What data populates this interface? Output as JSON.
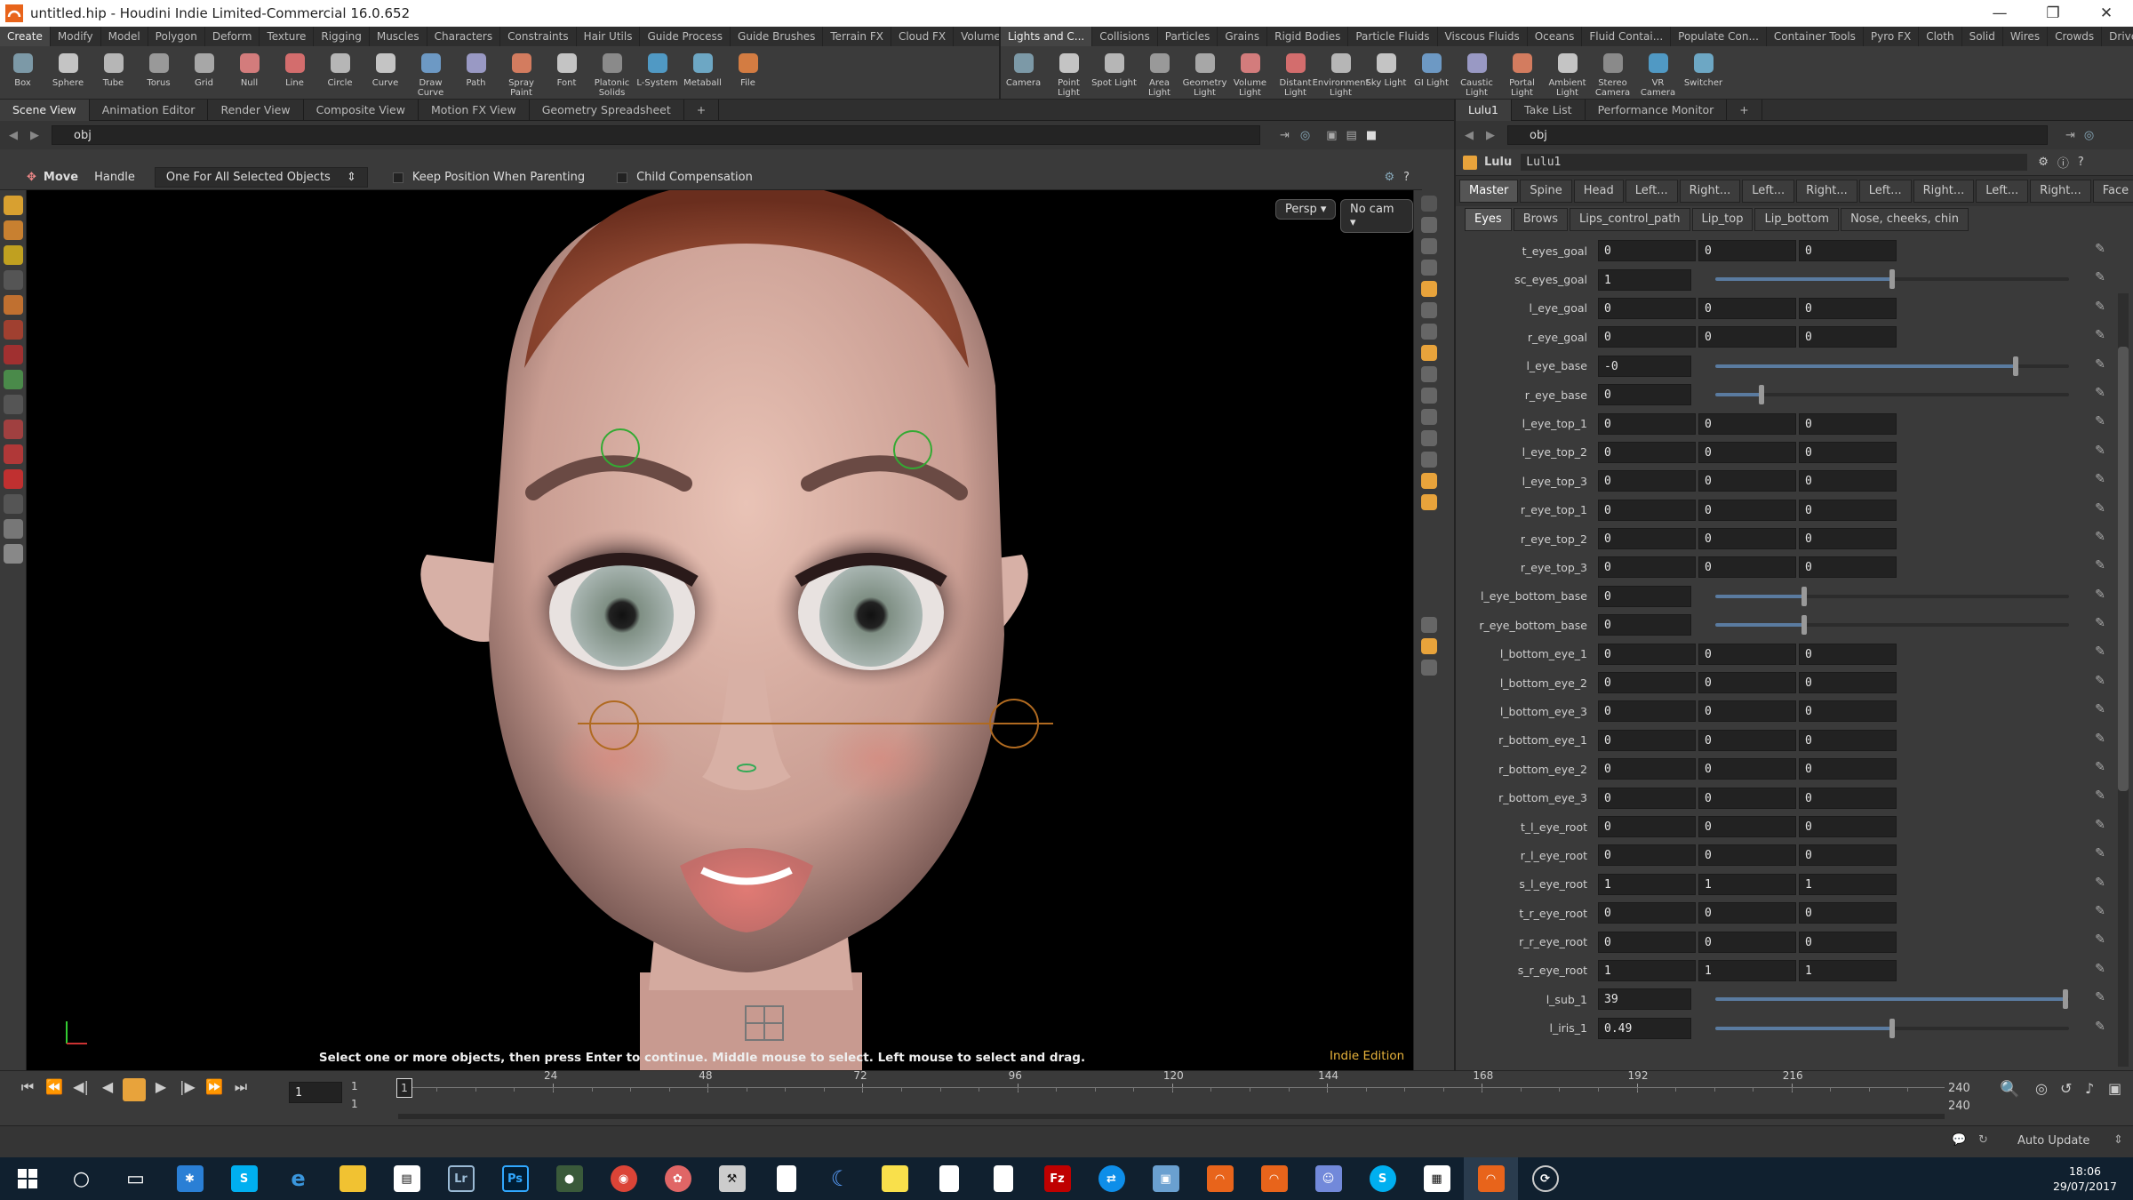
{
  "window": {
    "title": "untitled.hip - Houdini Indie Limited-Commercial 16.0.652",
    "controls": [
      "—",
      "❐",
      "✕"
    ]
  },
  "shelf_left": {
    "tabs": [
      "Create",
      "Modify",
      "Model",
      "Polygon",
      "Deform",
      "Texture",
      "Rigging",
      "Muscles",
      "Characters",
      "Constraints",
      "Hair Utils",
      "Guide Process",
      "Guide Brushes",
      "Terrain FX",
      "Cloud FX",
      "Volume"
    ],
    "tools": [
      {
        "label": "Box",
        "icon": "box-icon"
      },
      {
        "label": "Sphere",
        "icon": "sphere-icon"
      },
      {
        "label": "Tube",
        "icon": "tube-icon"
      },
      {
        "label": "Torus",
        "icon": "torus-icon"
      },
      {
        "label": "Grid",
        "icon": "grid-icon"
      },
      {
        "label": "Null",
        "icon": "null-icon"
      },
      {
        "label": "Line",
        "icon": "line-icon"
      },
      {
        "label": "Circle",
        "icon": "circle-icon"
      },
      {
        "label": "Curve",
        "icon": "curve-icon"
      },
      {
        "label": "Draw Curve",
        "icon": "draw-curve-icon"
      },
      {
        "label": "Path",
        "icon": "path-icon"
      },
      {
        "label": "Spray Paint",
        "icon": "spray-paint-icon"
      },
      {
        "label": "Font",
        "icon": "font-icon"
      },
      {
        "label": "Platonic Solids",
        "icon": "platonic-icon"
      },
      {
        "label": "L-System",
        "icon": "lsystem-icon"
      },
      {
        "label": "Metaball",
        "icon": "metaball-icon"
      },
      {
        "label": "File",
        "icon": "file-icon"
      }
    ]
  },
  "shelf_right": {
    "tabs": [
      "Lights and C...",
      "Collisions",
      "Particles",
      "Grains",
      "Rigid Bodies",
      "Particle Fluids",
      "Viscous Fluids",
      "Oceans",
      "Fluid Contai...",
      "Populate Con...",
      "Container Tools",
      "Pyro FX",
      "Cloth",
      "Solid",
      "Wires",
      "Crowds",
      "Drive Simula..."
    ],
    "tools": [
      {
        "label": "Camera",
        "icon": "camera-icon"
      },
      {
        "label": "Point Light",
        "icon": "point-light-icon"
      },
      {
        "label": "Spot Light",
        "icon": "spot-light-icon"
      },
      {
        "label": "Area Light",
        "icon": "area-light-icon"
      },
      {
        "label": "Geometry Light",
        "icon": "geometry-light-icon"
      },
      {
        "label": "Volume Light",
        "icon": "volume-light-icon"
      },
      {
        "label": "Distant Light",
        "icon": "distant-light-icon"
      },
      {
        "label": "Environment Light",
        "icon": "environment-light-icon"
      },
      {
        "label": "Sky Light",
        "icon": "sky-light-icon"
      },
      {
        "label": "GI Light",
        "icon": "gi-light-icon"
      },
      {
        "label": "Caustic Light",
        "icon": "caustic-light-icon"
      },
      {
        "label": "Portal Light",
        "icon": "portal-light-icon"
      },
      {
        "label": "Ambient Light",
        "icon": "ambient-light-icon"
      },
      {
        "label": "Stereo Camera",
        "icon": "stereo-camera-icon"
      },
      {
        "label": "VR Camera",
        "icon": "vr-camera-icon"
      },
      {
        "label": "Switcher",
        "icon": "switcher-icon"
      }
    ]
  },
  "left_pane": {
    "tabs": [
      "Scene View",
      "Animation Editor",
      "Render View",
      "Composite View",
      "Motion FX View",
      "Geometry Spreadsheet"
    ],
    "path": "obj"
  },
  "opbar": {
    "tool": "Move",
    "handle": "Handle",
    "mode": "One For All Selected Objects",
    "keep": "Keep Position When Parenting",
    "child": "Child Compensation"
  },
  "viewport": {
    "persp": "Persp ▾",
    "cam": "No cam ▾",
    "hint": "Select one or more objects, then press Enter to continue. Middle mouse to select. Left mouse to select and drag.",
    "edition": "Indie Edition"
  },
  "right_pane": {
    "tabs": [
      "Lulu1",
      "Take List",
      "Performance Monitor"
    ],
    "path": "obj",
    "node_type": "Lulu",
    "node_name": "Lulu1",
    "tabs1": [
      "Master",
      "Spine",
      "Head",
      "Left...",
      "Right...",
      "Left...",
      "Right...",
      "Left...",
      "Right...",
      "Left...",
      "Right...",
      "Face"
    ],
    "tabs2": [
      "Eyes",
      "Brows",
      "Lips_control_path",
      "Lip_top",
      "Lip_bottom",
      "Nose, cheeks, chin"
    ],
    "params": [
      {
        "label": "t_eyes_goal",
        "type": "vec",
        "v": [
          "0",
          "0",
          "0"
        ]
      },
      {
        "label": "sc_eyes_goal",
        "type": "slider",
        "v": "1",
        "pos": 0.5
      },
      {
        "label": "l_eye_goal",
        "type": "vec",
        "v": [
          "0",
          "0",
          "0"
        ]
      },
      {
        "label": "r_eye_goal",
        "type": "vec",
        "v": [
          "0",
          "0",
          "0"
        ]
      },
      {
        "label": "l_eye_base",
        "type": "slider",
        "v": "-0",
        "pos": 0.85
      },
      {
        "label": "r_eye_base",
        "type": "slider",
        "v": "0",
        "pos": 0.13
      },
      {
        "label": "l_eye_top_1",
        "type": "vec",
        "v": [
          "0",
          "0",
          "0"
        ]
      },
      {
        "label": "l_eye_top_2",
        "type": "vec",
        "v": [
          "0",
          "0",
          "0"
        ]
      },
      {
        "label": "l_eye_top_3",
        "type": "vec",
        "v": [
          "0",
          "0",
          "0"
        ]
      },
      {
        "label": "r_eye_top_1",
        "type": "vec",
        "v": [
          "0",
          "0",
          "0"
        ]
      },
      {
        "label": "r_eye_top_2",
        "type": "vec",
        "v": [
          "0",
          "0",
          "0"
        ]
      },
      {
        "label": "r_eye_top_3",
        "type": "vec",
        "v": [
          "0",
          "0",
          "0"
        ]
      },
      {
        "label": "l_eye_bottom_base",
        "type": "slider",
        "v": "0",
        "pos": 0.25
      },
      {
        "label": "r_eye_bottom_base",
        "type": "slider",
        "v": "0",
        "pos": 0.25
      },
      {
        "label": "l_bottom_eye_1",
        "type": "vec",
        "v": [
          "0",
          "0",
          "0"
        ]
      },
      {
        "label": "l_bottom_eye_2",
        "type": "vec",
        "v": [
          "0",
          "0",
          "0"
        ]
      },
      {
        "label": "l_bottom_eye_3",
        "type": "vec",
        "v": [
          "0",
          "0",
          "0"
        ]
      },
      {
        "label": "r_bottom_eye_1",
        "type": "vec",
        "v": [
          "0",
          "0",
          "0"
        ]
      },
      {
        "label": "r_bottom_eye_2",
        "type": "vec",
        "v": [
          "0",
          "0",
          "0"
        ]
      },
      {
        "label": "r_bottom_eye_3",
        "type": "vec",
        "v": [
          "0",
          "0",
          "0"
        ]
      },
      {
        "label": "t_l_eye_root",
        "type": "vec",
        "v": [
          "0",
          "0",
          "0"
        ]
      },
      {
        "label": "r_l_eye_root",
        "type": "vec",
        "v": [
          "0",
          "0",
          "0"
        ]
      },
      {
        "label": "s_l_eye_root",
        "type": "vec",
        "v": [
          "1",
          "1",
          "1"
        ]
      },
      {
        "label": "t_r_eye_root",
        "type": "vec",
        "v": [
          "0",
          "0",
          "0"
        ]
      },
      {
        "label": "r_r_eye_root",
        "type": "vec",
        "v": [
          "0",
          "0",
          "0"
        ]
      },
      {
        "label": "s_r_eye_root",
        "type": "vec",
        "v": [
          "1",
          "1",
          "1"
        ]
      },
      {
        "label": "l_sub_1",
        "type": "slider",
        "v": "39",
        "pos": 0.99
      },
      {
        "label": "l_iris_1",
        "type": "slider",
        "v": "0.49",
        "pos": 0.5
      }
    ]
  },
  "timeline": {
    "frame": "1",
    "start": "1",
    "start2": "1",
    "end": "240",
    "end2": "240",
    "ticks": [
      "24",
      "48",
      "72",
      "96",
      "120",
      "144",
      "168",
      "192",
      "216"
    ]
  },
  "status": {
    "auto_update": "Auto Update"
  },
  "taskbar": {
    "time": "18:06",
    "date": "29/07/2017"
  },
  "colors": {
    "accent": "#e8a33b",
    "slider": "#5a7ba0"
  }
}
